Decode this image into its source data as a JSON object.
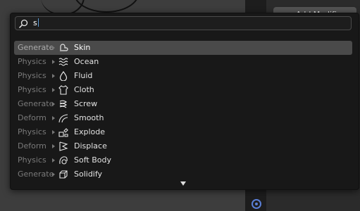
{
  "search": {
    "value": "s"
  },
  "background": {
    "add_modifier_label": "Add Modifier"
  },
  "results": [
    {
      "category": "Generate",
      "icon": "skin-icon",
      "label": "Skin",
      "active": true
    },
    {
      "category": "Physics",
      "icon": "ocean-icon",
      "label": "Ocean"
    },
    {
      "category": "Physics",
      "icon": "fluid-icon",
      "label": "Fluid"
    },
    {
      "category": "Physics",
      "icon": "cloth-icon",
      "label": "Cloth"
    },
    {
      "category": "Generate",
      "icon": "screw-icon",
      "label": "Screw"
    },
    {
      "category": "Deform",
      "icon": "smooth-icon",
      "label": "Smooth"
    },
    {
      "category": "Physics",
      "icon": "explode-icon",
      "label": "Explode"
    },
    {
      "category": "Deform",
      "icon": "displace-icon",
      "label": "Displace"
    },
    {
      "category": "Physics",
      "icon": "soft-body-icon",
      "label": "Soft Body"
    },
    {
      "category": "Generate",
      "icon": "solidify-icon",
      "label": "Solidify"
    }
  ],
  "colors": {
    "highlight": "#4a4a4a",
    "popup_bg": "#181818",
    "caret": "#5b9bd5"
  }
}
